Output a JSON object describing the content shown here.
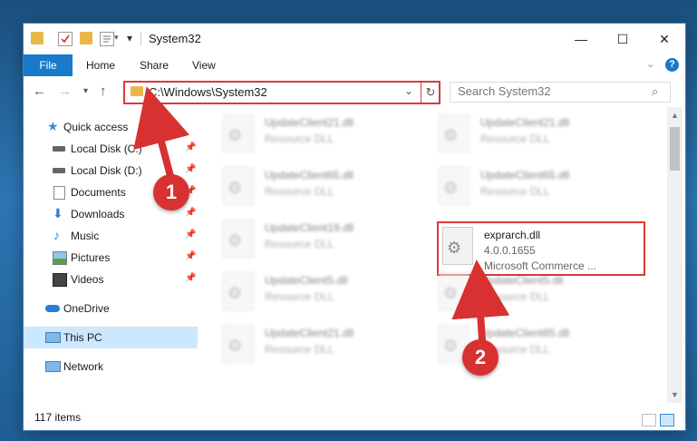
{
  "window": {
    "title": "System32",
    "controls": {
      "minimize": "—",
      "maximize": "☐",
      "close": "✕"
    }
  },
  "ribbon": {
    "tabs": [
      "File",
      "Home",
      "Share",
      "View"
    ]
  },
  "navigation": {
    "address": "C:\\Windows\\System32",
    "search_placeholder": "Search System32"
  },
  "sidebar": {
    "items": [
      {
        "label": "Quick access",
        "icon": "star-icon",
        "pinned": false
      },
      {
        "label": "Local Disk (C:)",
        "icon": "drive-icon",
        "pinned": true
      },
      {
        "label": "Local Disk (D:)",
        "icon": "drive-icon",
        "pinned": true
      },
      {
        "label": "Documents",
        "icon": "documents-icon",
        "pinned": true
      },
      {
        "label": "Downloads",
        "icon": "downloads-icon",
        "pinned": true
      },
      {
        "label": "Music",
        "icon": "music-icon",
        "pinned": true
      },
      {
        "label": "Pictures",
        "icon": "pictures-icon",
        "pinned": true
      },
      {
        "label": "Videos",
        "icon": "videos-icon",
        "pinned": true
      },
      {
        "label": "OneDrive",
        "icon": "cloud-icon",
        "pinned": false
      },
      {
        "label": "This PC",
        "icon": "computer-icon",
        "pinned": false,
        "selected": true
      },
      {
        "label": "Network",
        "icon": "network-icon",
        "pinned": false
      }
    ]
  },
  "files": [
    {
      "name": "UpdateClient21.dll",
      "type": "Resource DLL",
      "blurred": true
    },
    {
      "name": "UpdateClient21.dll",
      "type": "Resource DLL",
      "blurred": true
    },
    {
      "name": "UpdateClient65.dll",
      "type": "Resource DLL",
      "blurred": true
    },
    {
      "name": "UpdateClient65.dll",
      "type": "Resource DLL",
      "blurred": true
    },
    {
      "name": "UpdateClient19.dll",
      "type": "Resource DLL",
      "blurred": true
    },
    {
      "name": "exprarch.dll",
      "version": "4.0.0.1655",
      "company": "Microsoft Commerce ...",
      "blurred": false,
      "highlighted": true
    },
    {
      "name": "UpdateClient5.dll",
      "type": "Resource DLL",
      "blurred": true
    },
    {
      "name": "UpdateClient5.dll",
      "type": "Resource DLL",
      "blurred": true
    },
    {
      "name": "UpdateClient21.dll",
      "type": "Resource DLL",
      "blurred": true
    },
    {
      "name": "UpdateClient65.dll",
      "type": "Resource DLL",
      "blurred": true
    }
  ],
  "status": {
    "item_count": "117 items"
  },
  "annotations": {
    "callout_1": "1",
    "callout_2": "2",
    "color": "#d83131"
  },
  "colors": {
    "accent": "#1979ca",
    "highlight": "#d93a3a",
    "selected": "#cce8ff"
  }
}
